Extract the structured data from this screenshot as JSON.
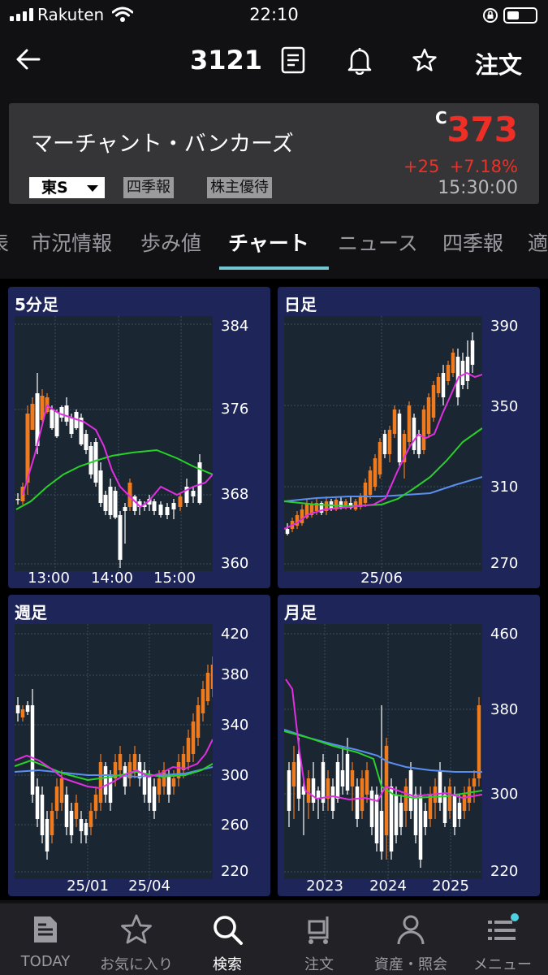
{
  "status": {
    "carrier": "Rakuten",
    "time": "22:10"
  },
  "nav": {
    "code": "3121",
    "order_label": "注文"
  },
  "quote": {
    "name": "マーチャント・バンカーズ",
    "close_marker": "C",
    "price": "373",
    "change": "+25",
    "change_pct": "+7.18%",
    "time": "15:30:00",
    "market": "東S",
    "tags": [
      "四季報",
      "株主優待"
    ],
    "up_color": "#ef2f25"
  },
  "tabs": [
    "市況情報",
    "歩み値",
    "チャート",
    "ニュース",
    "四季報"
  ],
  "active_tab": "チャート",
  "charts": {
    "intraday": {
      "title": "5分足",
      "y_ticks": [
        "384",
        "376",
        "368",
        "360"
      ],
      "x_ticks": [
        "13:00",
        "14:00",
        "15:00"
      ]
    },
    "daily": {
      "title": "日足",
      "y_ticks": [
        "390",
        "350",
        "310",
        "270"
      ],
      "x_ticks": [
        "25/06"
      ]
    },
    "weekly": {
      "title": "週足",
      "y_ticks": [
        "420",
        "380",
        "340",
        "300",
        "260",
        "220"
      ],
      "x_ticks": [
        "25/01",
        "25/04"
      ]
    },
    "monthly": {
      "title": "月足",
      "y_ticks": [
        "460",
        "380",
        "300",
        "220"
      ],
      "x_ticks": [
        "2023",
        "2024",
        "2025"
      ]
    }
  },
  "colors": {
    "panel_bg": "#1d2559",
    "plot_bg": "#1a2733",
    "candle_up": "#f07a1e",
    "candle_down": "#ffffff",
    "ma_short": "#e02ee0",
    "ma_mid": "#2ad02a",
    "ma_long": "#5a8ef0",
    "accent": "#74c7d0"
  },
  "bottom_nav": [
    {
      "label": "TODAY",
      "icon": "news-icon"
    },
    {
      "label": "お気に入り",
      "icon": "star-icon"
    },
    {
      "label": "検索",
      "icon": "search-icon"
    },
    {
      "label": "注文",
      "icon": "cart-icon"
    },
    {
      "label": "資産・照会",
      "icon": "person-icon"
    },
    {
      "label": "メニュー",
      "icon": "menu-icon"
    }
  ],
  "bottom_active": "検索"
}
